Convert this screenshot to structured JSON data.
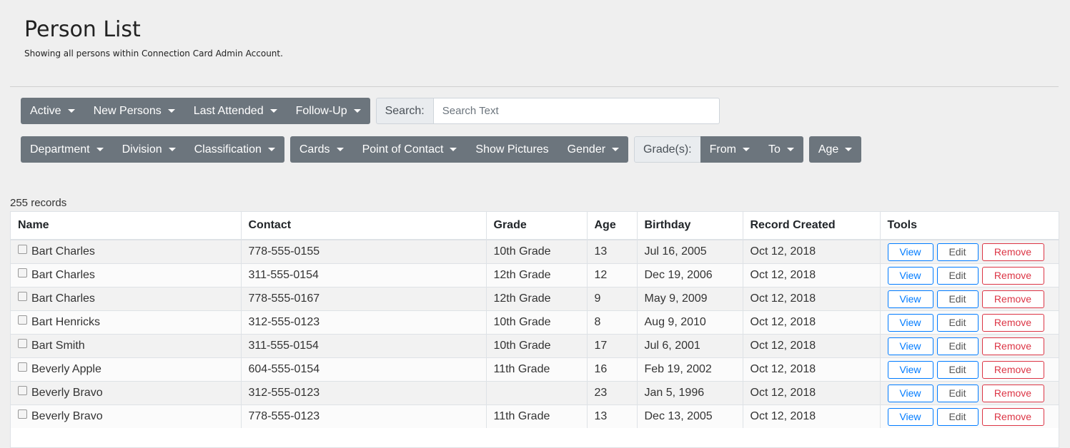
{
  "header": {
    "title": "Person List",
    "subtitle": "Showing all persons within Connection Card Admin Account."
  },
  "filters_row1": {
    "group1": [
      "Active",
      "New Persons",
      "Last Attended",
      "Follow-Up"
    ],
    "search_label": "Search:",
    "search_placeholder": "Search Text",
    "search_value": ""
  },
  "filters_row2": {
    "group1": [
      "Department",
      "Division",
      "Classification"
    ],
    "group2_dropdowns": [
      "Cards",
      "Point of Contact"
    ],
    "group2_plain": "Show Pictures",
    "group2_gender": "Gender",
    "grades_label": "Grade(s):",
    "grades_from": "From",
    "grades_to": "To",
    "age": "Age"
  },
  "records_count": "255 records",
  "table": {
    "columns": [
      "Name",
      "Contact",
      "Grade",
      "Age",
      "Birthday",
      "Record Created",
      "Tools"
    ],
    "tools": {
      "view": "View",
      "edit": "Edit",
      "remove": "Remove"
    },
    "rows": [
      {
        "name": "Bart Charles",
        "contact": "778-555-0155",
        "grade": "10th Grade",
        "age": "13",
        "birthday": "Jul 16, 2005",
        "created": "Oct 12, 2018"
      },
      {
        "name": "Bart Charles",
        "contact": "311-555-0154",
        "grade": "12th Grade",
        "age": "12",
        "birthday": "Dec 19, 2006",
        "created": "Oct 12, 2018"
      },
      {
        "name": "Bart Charles",
        "contact": "778-555-0167",
        "grade": "12th Grade",
        "age": "9",
        "birthday": "May 9, 2009",
        "created": "Oct 12, 2018"
      },
      {
        "name": "Bart Henricks",
        "contact": "312-555-0123",
        "grade": "10th Grade",
        "age": "8",
        "birthday": "Aug 9, 2010",
        "created": "Oct 12, 2018"
      },
      {
        "name": "Bart Smith",
        "contact": "311-555-0154",
        "grade": "10th Grade",
        "age": "17",
        "birthday": "Jul 6, 2001",
        "created": "Oct 12, 2018"
      },
      {
        "name": "Beverly Apple",
        "contact": "604-555-0154",
        "grade": "11th Grade",
        "age": "16",
        "birthday": "Feb 19, 2002",
        "created": "Oct 12, 2018"
      },
      {
        "name": "Beverly Bravo",
        "contact": "312-555-0123",
        "grade": "",
        "age": "23",
        "birthday": "Jan 5, 1996",
        "created": "Oct 12, 2018"
      },
      {
        "name": "Beverly Bravo",
        "contact": "778-555-0123",
        "grade": "11th Grade",
        "age": "13",
        "birthday": "Dec 13, 2005",
        "created": "Oct 12, 2018"
      }
    ]
  }
}
